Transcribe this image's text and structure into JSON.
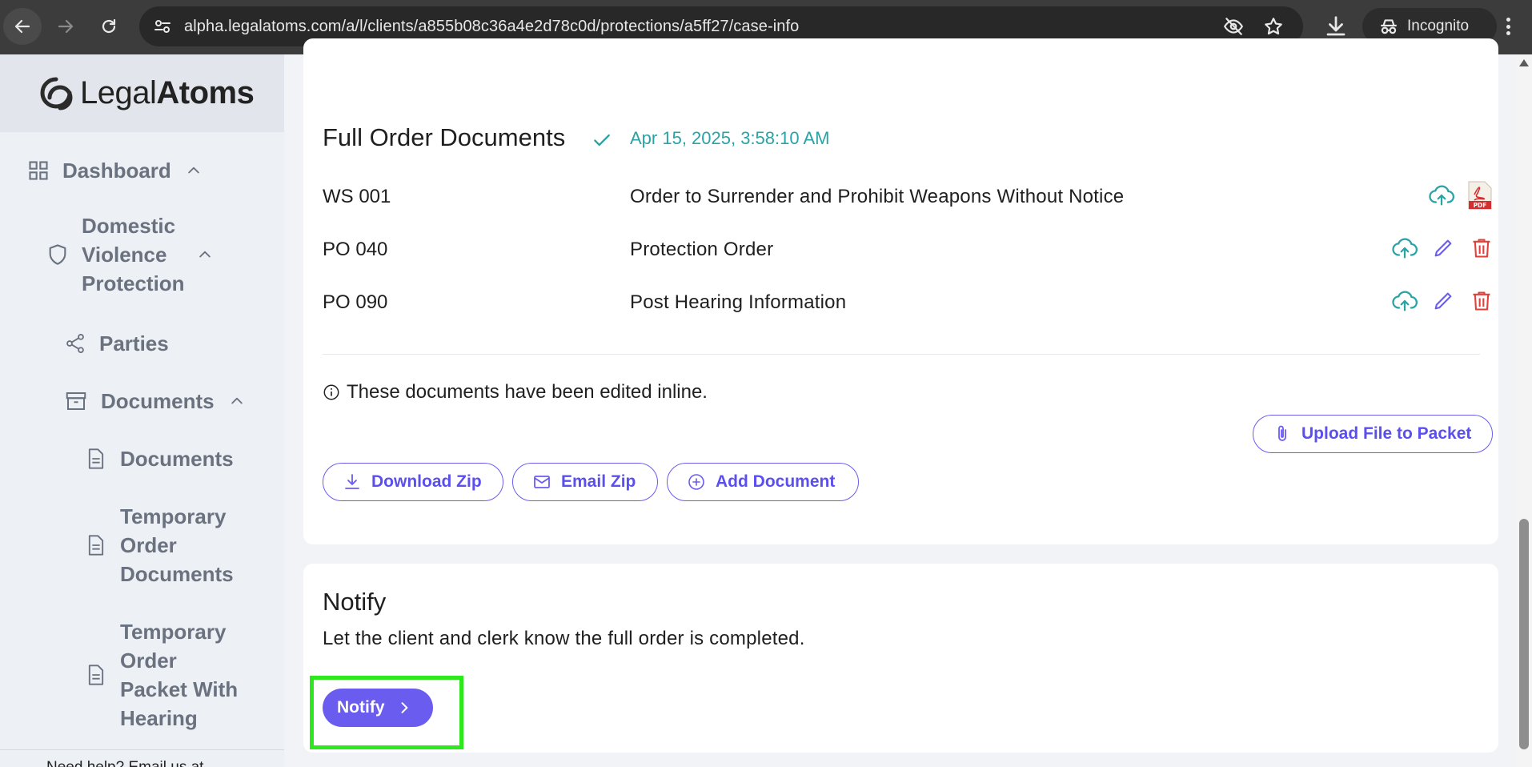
{
  "browser": {
    "url": "alpha.legalatoms.com/a/l/clients/a855b08c36a4e2d78c0d/protections/a5ff27/case-info",
    "profile_label": "Incognito"
  },
  "sidebar": {
    "logo_light": "Legal",
    "logo_bold": "Atoms",
    "items": [
      {
        "label": "Dashboard",
        "icon": "grid-icon"
      },
      {
        "label": "Domestic Violence Protection",
        "icon": "shield-icon"
      },
      {
        "label": "Parties",
        "icon": "share-icon"
      },
      {
        "label": "Documents",
        "icon": "archive-icon"
      },
      {
        "label": "Documents",
        "icon": "file-icon"
      },
      {
        "label": "Temporary Order Documents",
        "icon": "file-icon"
      },
      {
        "label": "Temporary Order Packet With Hearing",
        "icon": "file-icon"
      }
    ],
    "help_text": "Need help? Email us at"
  },
  "full_order": {
    "title": "Full Order Documents",
    "timestamp": "Apr 15, 2025, 3:58:10 AM",
    "rows": [
      {
        "code": "WS 001",
        "name": "Order to Surrender and Prohibit Weapons Without Notice"
      },
      {
        "code": "PO 040",
        "name": "Protection Order"
      },
      {
        "code": "PO 090",
        "name": "Post Hearing Information"
      }
    ],
    "info_text": "These documents have been edited inline.",
    "upload_label": "Upload File to Packet",
    "download_zip_label": "Download Zip",
    "email_zip_label": "Email Zip",
    "add_document_label": "Add Document"
  },
  "notify": {
    "title": "Notify",
    "description": "Let the client and clerk know the full order is completed.",
    "button_label": "Notify"
  },
  "colors": {
    "accent": "#6b5cf0",
    "teal": "#2aa3a6",
    "danger": "#e0413a",
    "highlight": "#2ee81e"
  }
}
